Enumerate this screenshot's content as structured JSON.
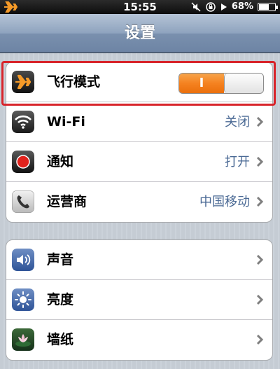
{
  "status_bar": {
    "time": "15:55",
    "battery_percent": "68%",
    "battery_level": 0.68,
    "icons": [
      "airplane-icon",
      "mute-icon",
      "rotation-lock-icon",
      "play-icon",
      "battery-icon"
    ]
  },
  "nav": {
    "title": "设置"
  },
  "group1": {
    "items": [
      {
        "label": "飞行模式",
        "icon": "airplane-icon",
        "toggle_label": "I",
        "toggle_on": true
      },
      {
        "label": "Wi-Fi",
        "icon": "wifi-icon",
        "value": "关闭"
      },
      {
        "label": "通知",
        "icon": "notification-icon",
        "value": "打开"
      },
      {
        "label": "运营商",
        "icon": "phone-icon",
        "value": "中国移动"
      }
    ]
  },
  "group2": {
    "items": [
      {
        "label": "声音",
        "icon": "speaker-icon"
      },
      {
        "label": "亮度",
        "icon": "brightness-icon"
      },
      {
        "label": "墙纸",
        "icon": "wallpaper-icon"
      }
    ]
  },
  "colors": {
    "toggle_on": "#f58220",
    "highlight_border": "#d8242b",
    "value_text": "#4b6a95"
  }
}
